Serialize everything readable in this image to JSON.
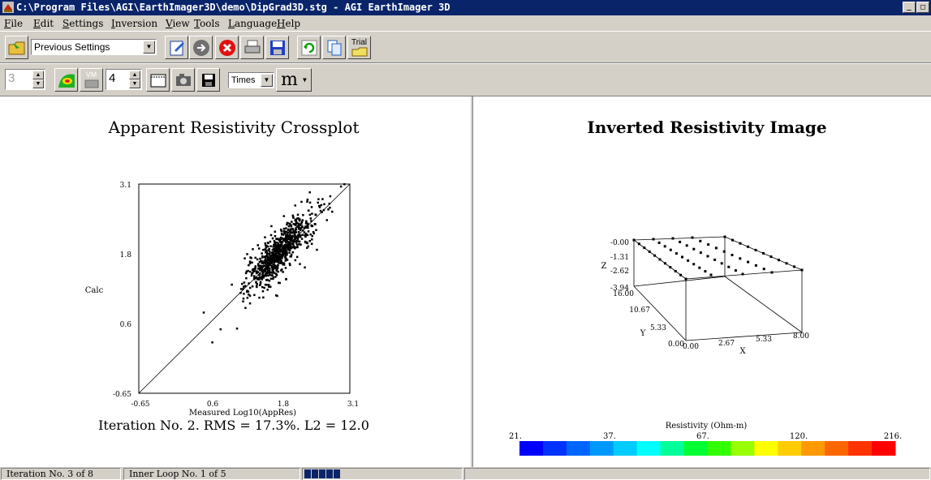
{
  "window": {
    "title": "C:\\Program Files\\AGI\\EarthImager3D\\demo\\DipGrad3D.stg - AGI EarthImager 3D"
  },
  "menu": [
    {
      "u": "F",
      "rest": "ile"
    },
    {
      "u": "E",
      "rest": "dit"
    },
    {
      "u": "S",
      "rest": "ettings"
    },
    {
      "u": "I",
      "rest": "nversion"
    },
    {
      "u": "V",
      "rest": "iew"
    },
    {
      "u": "T",
      "rest": "ools"
    },
    {
      "u": "L",
      "rest": "anguage"
    },
    {
      "u": "H",
      "rest": "elp"
    }
  ],
  "toolbar1": {
    "settings_value": "Previous Settings",
    "trial_label": "Trial",
    "icons": [
      "open-folder-icon",
      "edit-settings-icon",
      "forward-icon",
      "stop-icon",
      "print-icon",
      "save-icon",
      "refresh-icon",
      "copy-icon",
      "trial-icon"
    ]
  },
  "toolbar2": {
    "spin1_value": "3",
    "vm_label": "VM",
    "spin2_value": "4",
    "font_value": "Times",
    "font_size_glyph": "m"
  },
  "left_plot": {
    "title": "Apparent Resistivity Crossplot",
    "ylabel": "Calc",
    "xlabel": "Measured Log10(AppRes)",
    "footer": "Iteration No. 2.  RMS = 17.3%.  L2 = 12.0",
    "yticks": [
      "3.1",
      "1.8",
      "0.6",
      "-0.65"
    ],
    "xticks": [
      "-0.65",
      "0.6",
      "1.8",
      "3.1"
    ]
  },
  "right_plot": {
    "title": "Inverted Resistivity Image",
    "z_label": "Z",
    "y_label": "Y",
    "x_label": "X",
    "z_ticks": [
      "-0.00",
      "-1.31",
      "-2.62",
      "-3.94"
    ],
    "y_ticks": [
      "16.00",
      "10.67",
      "5.33",
      "0.00"
    ],
    "x_ticks": [
      "0.00",
      "2.67",
      "5.33",
      "8.00"
    ],
    "colorbar_title": "Resistivity (Ohm-m)",
    "colorbar_ticks": [
      "21.",
      "37.",
      "67.",
      "120.",
      "216."
    ],
    "colors": [
      "#0000ff",
      "#0033ff",
      "#0066ff",
      "#0099ff",
      "#00ccff",
      "#00ffff",
      "#00ff99",
      "#00ff33",
      "#33ff00",
      "#99ff00",
      "#ffff00",
      "#ffcc00",
      "#ff9900",
      "#ff6600",
      "#ff3300",
      "#ff0000"
    ]
  },
  "status": {
    "iteration": "Iteration No. 3 of 8",
    "inner_loop": "Inner Loop No. 1 of 5",
    "progress_blocks": 5
  },
  "chart_data": [
    {
      "type": "scatter",
      "title": "Apparent Resistivity Crossplot",
      "xlabel": "Measured Log10(AppRes)",
      "ylabel": "Calc",
      "xlim": [
        -0.65,
        3.1
      ],
      "ylim": [
        -0.65,
        3.1
      ],
      "reference_line": "y = x",
      "approx_points_x": [
        0.5,
        0.8,
        1.0,
        1.2,
        1.4,
        1.5,
        1.6,
        1.7,
        1.8,
        1.9,
        2.0,
        2.1,
        2.2,
        2.4,
        2.6,
        3.0
      ],
      "approx_points_y": [
        0.8,
        0.5,
        1.3,
        1.0,
        1.4,
        1.5,
        1.6,
        1.75,
        1.8,
        1.95,
        2.0,
        2.1,
        2.3,
        2.2,
        2.6,
        3.1
      ]
    }
  ]
}
